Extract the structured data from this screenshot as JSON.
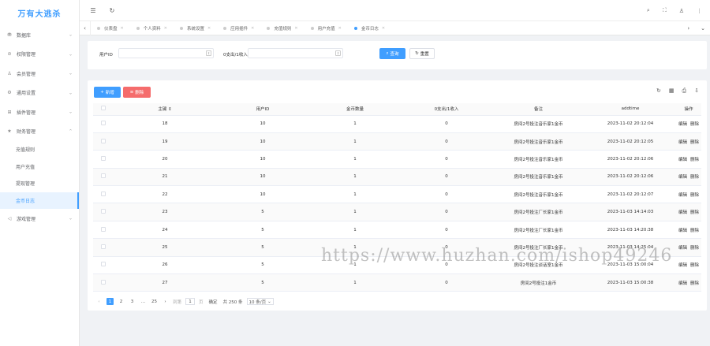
{
  "app": {
    "title": "万有大逃杀"
  },
  "sidebar": {
    "items": [
      {
        "icon": "database-icon",
        "glyph": "⛃",
        "label": "数据库",
        "has_children": true
      },
      {
        "icon": "shield-icon",
        "glyph": "⊘",
        "label": "权限管理",
        "has_children": true
      },
      {
        "icon": "user-icon",
        "glyph": "♙",
        "label": "会员管理",
        "has_children": true
      },
      {
        "icon": "gear-icon",
        "glyph": "⚙",
        "label": "通用设置",
        "has_children": true
      },
      {
        "icon": "plugin-icon",
        "glyph": "⊞",
        "label": "插件管理",
        "has_children": true
      },
      {
        "icon": "finance-icon",
        "glyph": "★",
        "label": "财务管理",
        "has_children": true,
        "expanded": true
      }
    ],
    "finance_sub": [
      "充值规则",
      "用户充值",
      "提现管理",
      "金币日志"
    ],
    "active_sub": "金币日志",
    "after": {
      "icon": "game-icon",
      "glyph": "◁",
      "label": "游戏管理"
    }
  },
  "tabs": {
    "items": [
      "仪表盘",
      "个人资料",
      "系统设置",
      "应用插件",
      "充值规则",
      "用户充值",
      "金币日志"
    ],
    "active": "金币日志"
  },
  "search": {
    "user_id_label": "用户ID",
    "user_id_value": "",
    "type_label": "0支出/1收入",
    "type_value": "",
    "search_button": "查询",
    "reset_button": "重置"
  },
  "table": {
    "add_button": "新增",
    "delete_button": "删除",
    "columns": [
      "主键",
      "用户ID",
      "金币数量",
      "0支出/1收入",
      "备注",
      "addtime",
      "操作"
    ],
    "edit_label": "编辑",
    "remove_label": "删除",
    "rows": [
      {
        "id": "18",
        "user_id": "10",
        "amount": "1",
        "type": "0",
        "note": "房间2号投注音乐家1金币",
        "addtime": "2023-11-02 20:12:04"
      },
      {
        "id": "19",
        "user_id": "10",
        "amount": "1",
        "type": "0",
        "note": "房间2号投注音乐家1金币",
        "addtime": "2023-11-02 20:12:05"
      },
      {
        "id": "20",
        "user_id": "10",
        "amount": "1",
        "type": "0",
        "note": "房间2号投注音乐家1金币",
        "addtime": "2023-11-02 20:12:06"
      },
      {
        "id": "21",
        "user_id": "10",
        "amount": "1",
        "type": "0",
        "note": "房间2号投注音乐家1金币",
        "addtime": "2023-11-02 20:12:06"
      },
      {
        "id": "22",
        "user_id": "10",
        "amount": "1",
        "type": "0",
        "note": "房间2号投注音乐家1金币",
        "addtime": "2023-11-02 20:12:07"
      },
      {
        "id": "23",
        "user_id": "5",
        "amount": "1",
        "type": "0",
        "note": "房间2号投注厂长家1金币",
        "addtime": "2023-11-03 14:14:03"
      },
      {
        "id": "24",
        "user_id": "5",
        "amount": "1",
        "type": "0",
        "note": "房间2号投注厂长家1金币",
        "addtime": "2023-11-03 14:20:38"
      },
      {
        "id": "25",
        "user_id": "5",
        "amount": "1",
        "type": "0",
        "note": "房间2号投注厂长家1金币",
        "addtime": "2023-11-03 14:25:04"
      },
      {
        "id": "26",
        "user_id": "5",
        "amount": "1",
        "type": "0",
        "note": "房间2号投注谈话室1金币",
        "addtime": "2023-11-03 15:00:04"
      },
      {
        "id": "27",
        "user_id": "5",
        "amount": "1",
        "type": "0",
        "note": "房间2号投注1金币",
        "addtime": "2023-11-03 15:00:38"
      }
    ]
  },
  "pager": {
    "pages": [
      "1",
      "2",
      "3",
      "...",
      "25"
    ],
    "active": "1",
    "goto_label": "到第",
    "goto_value": "1",
    "page_suffix": "页",
    "confirm": "确定",
    "total": "共 250 条",
    "size": "10 条/页"
  },
  "watermark": "https://www.huzhan.com/ishop49246",
  "colors": {
    "primary": "#409eff",
    "danger": "#f56c6c",
    "logo": "#409eff"
  }
}
